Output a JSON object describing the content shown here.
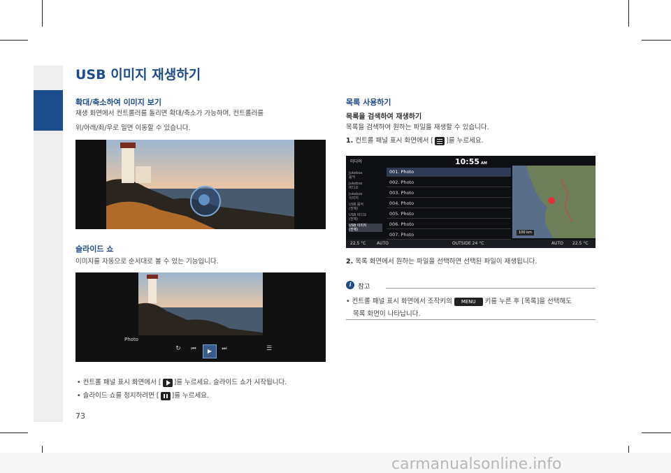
{
  "page": {
    "title": "USB 이미지 재생하기",
    "page_number": "73",
    "watermark": "carmanualsonline.info"
  },
  "left": {
    "section1": {
      "heading": "확대/축소하여 이미지 보기",
      "line1": "재생 화면에서 컨트롤러를 돌리면 확대/축소가 가능하며, 컨트롤러를",
      "line2": "위/아래/좌/우로 밀면 이동할 수 있습니다."
    },
    "section2": {
      "heading": "슬라이드 쇼",
      "text": "이미지를 자동으로 순서대로 볼 수 있는 기능입니다.",
      "screen_label": "Photo"
    },
    "bullets": [
      {
        "before": "컨트롤 패널 표시 화면에서 [",
        "after": "]를 누르세요. 슬라이드 쇼가 시작됩니다.",
        "icon": "play-icon"
      },
      {
        "before": "슬라이드 쇼를 정지하려면 [",
        "after": "]를 누르세요.",
        "icon": "pause-icon"
      }
    ]
  },
  "right": {
    "heading": "목록 사용하기",
    "subheading": "목록을 검색하여 재생하기",
    "text": "목록을 검색하여 원하는 파일을 재생할 수 있습니다.",
    "step1": {
      "num": "1.",
      "before": "컨트롤 패널 표시 화면에서 [",
      "after": "]를 누르세요.",
      "icon": "list-icon"
    },
    "step2": {
      "num": "2.",
      "text": "목록 화면에서 원하는 파일을 선택하면 선택된 파일이 재생됩니다."
    },
    "screen": {
      "header_label": "미디어",
      "clock": "10:55",
      "ampm": "AM",
      "sidebar": [
        [
          "Jukebox",
          "음악"
        ],
        [
          "Jukebox",
          "비디오"
        ],
        [
          "Jukebox",
          "이미지"
        ],
        [
          "USB 음악",
          "(전체)"
        ],
        [
          "USB 비디오",
          "(전체)"
        ],
        [
          "USB 이미지",
          "(전체)"
        ]
      ],
      "files": [
        "001. Photo",
        "002. Photo",
        "003. Photo",
        "004. Photo",
        "005. Photo",
        "006. Photo",
        "007. Photo"
      ],
      "scale": "100 km",
      "status": {
        "temp_left": "22.5 °C",
        "auto_left": "AUTO",
        "outside": "OUTSIDE  24 °C",
        "auto_right": "AUTO",
        "temp_right": "22.5 °C"
      }
    },
    "note": {
      "title": "참고",
      "line1_before": "컨트롤 패널 표시 화면에서 조작키의",
      "menu": "MENU",
      "line1_after": "키를 누른 후 [목록]을 선택해도",
      "line2": "목록 화면이 나타납니다."
    }
  },
  "colors": {
    "accent": "#1d4c8c",
    "screen_bg": "#111111"
  }
}
